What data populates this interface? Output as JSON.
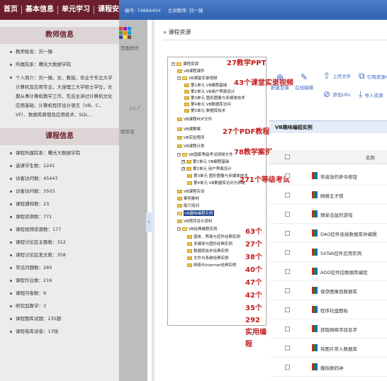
{
  "topnav": [
    "首页",
    "基本信息",
    "单元学习",
    "课程安"
  ],
  "header": {
    "id_label": "编号: 7488A404",
    "teacher_label": "主讲教师: 刘一臻"
  },
  "teacher": {
    "title": "教师信息",
    "items": [
      "教师姓名：刘一臻",
      "所属院系：曙光大数据学院",
      "个人简介：刘一臻，女，教授，毕业于东北大学计算机及应用专业，大连理工大学硕士学位，长期从事计算机教学工作，先后主讲过计算机文化应用基础、计算机程序设计语言（VB、C、VF）、数据库原理及应用技术、SQL..."
    ]
  },
  "course": {
    "title": "课程信息",
    "items": [
      "课程所属院系：曙光大数据学院",
      "选课学生数：2241",
      "访客访问数：45447",
      "访客访问数：3503",
      "课程通知数：23",
      "课程资源数：771",
      "课程视频资源数：177",
      "课程讨论区主题数：312",
      "课程讨论区发文数：358",
      "常见问题数：285",
      "课程作业数：216",
      "课程问卷数：9",
      "研究型教学：3",
      "课程题库试题：235题",
      "课程卷库试卷：13张"
    ]
  },
  "shade": {
    "style_label": "页面样式",
    "design_label": "程序设"
  },
  "main": {
    "breadcrumb": "» 课程资源",
    "panel_title": "VB趣味编程实例",
    "col_name": "名称",
    "toolbar": {
      "new_folder": "新建目录",
      "online_edit": "在线编辑",
      "upload": "上传文件",
      "add_url": "添加URL",
      "ref": "引用资源中",
      "import": "导入资源"
    },
    "tree": [
      "课程资源",
      "VB课程课件",
      "VB课堂实录视频",
      "第1单元 VB编程基础",
      "第2单元 VB用户界面设计",
      "第3单元 图形图像与多媒体技术",
      "第4单元 VB数据库访问",
      "第5单元 数据库技术",
      "VB课程PDF文件",
      "VB课教案",
      "VB实验程序",
      "VB课程计划",
      "VB国家等级考试视频文件",
      "第1单元 VB编程基础",
      "第2单元 用户界面设计",
      "第3单元 图形图像与多媒体技术",
      "第4单元 VB数据库访问与系统",
      "VB课程实训",
      "案例素材",
      "能力培训",
      "VB趣味编程实例",
      "VB程序设计资料",
      "VB经典编程实例",
      "窗体、界面与控件经典实例",
      "多媒体与图形经典实例",
      "数据库技术经典实例",
      "文件与系统经典实例",
      "网络与Internet经典实例"
    ],
    "files": [
      "带音效的命令按钮",
      "网格五子棋",
      "猜单击鼠的游戏",
      "DAO控件连接数据库并编辑",
      "SSTab控件应用实例",
      "ADO控件控数据库编程",
      "保存图像到数据库",
      "程序托盘图标",
      "获取网络字段名字",
      "将图片存入数据库",
      "模拟数码钟"
    ]
  },
  "annotations": {
    "ppt": "27教学PPT",
    "video": "43个课堂实录视频",
    "pdf": "27个PDF教程",
    "cases": "78教学案例",
    "exam": "271个等级考试",
    "counts": [
      "63个",
      "27个",
      "38个",
      "40个",
      "47个",
      "42个",
      "35个"
    ],
    "total": "292实用编程"
  }
}
